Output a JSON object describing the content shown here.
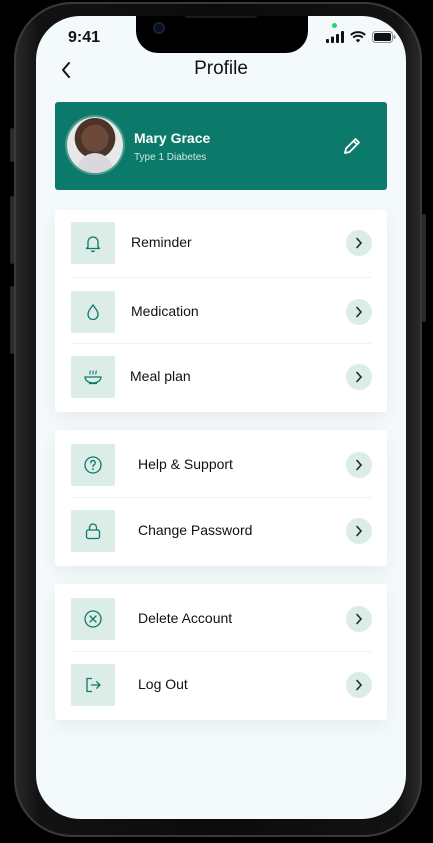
{
  "status_bar": {
    "time": "9:41"
  },
  "header": {
    "title": "Profile"
  },
  "profile": {
    "name": "Mary Grace",
    "condition": "Type 1 Diabetes"
  },
  "groups": [
    {
      "items": [
        {
          "label": "Reminder",
          "icon": "bell-icon"
        },
        {
          "label": "Medication",
          "icon": "drop-icon"
        },
        {
          "label": "Meal plan",
          "icon": "meal-icon"
        }
      ]
    },
    {
      "items": [
        {
          "label": "Help & Support",
          "icon": "question-circle-icon"
        },
        {
          "label": "Change Password",
          "icon": "lock-icon"
        }
      ]
    },
    {
      "items": [
        {
          "label": "Delete Account",
          "icon": "x-circle-icon"
        },
        {
          "label": "Log Out",
          "icon": "logout-icon"
        }
      ]
    }
  ],
  "colors": {
    "brand": "#0c7a6b",
    "icon_bg": "#dcece7",
    "screen_bg": "#f4fafb"
  }
}
